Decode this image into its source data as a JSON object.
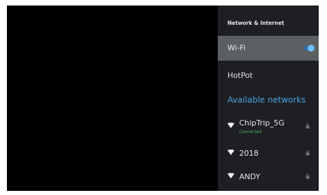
{
  "panel": {
    "title": "Network & Internet",
    "wifi": {
      "label": "Wi-Fi",
      "enabled": true
    },
    "hotspot": {
      "label": "HotPot"
    },
    "available_header": "Available networks",
    "networks": [
      {
        "ssid": "ChipTrip_5G",
        "status": "Connected",
        "icon": "wifi-icon",
        "secured": true
      },
      {
        "ssid": "2018",
        "icon": "wifi-icon",
        "secured": true
      },
      {
        "ssid": "ANDY",
        "icon": "wifi-icon",
        "secured": true
      }
    ]
  },
  "colors": {
    "panel_bg": "#1d1f22",
    "selected_row": "#5c5f62",
    "accent_blue": "#4da3e0",
    "toggle_on": "#6cc0f7",
    "connected_green": "#4dbb63"
  }
}
